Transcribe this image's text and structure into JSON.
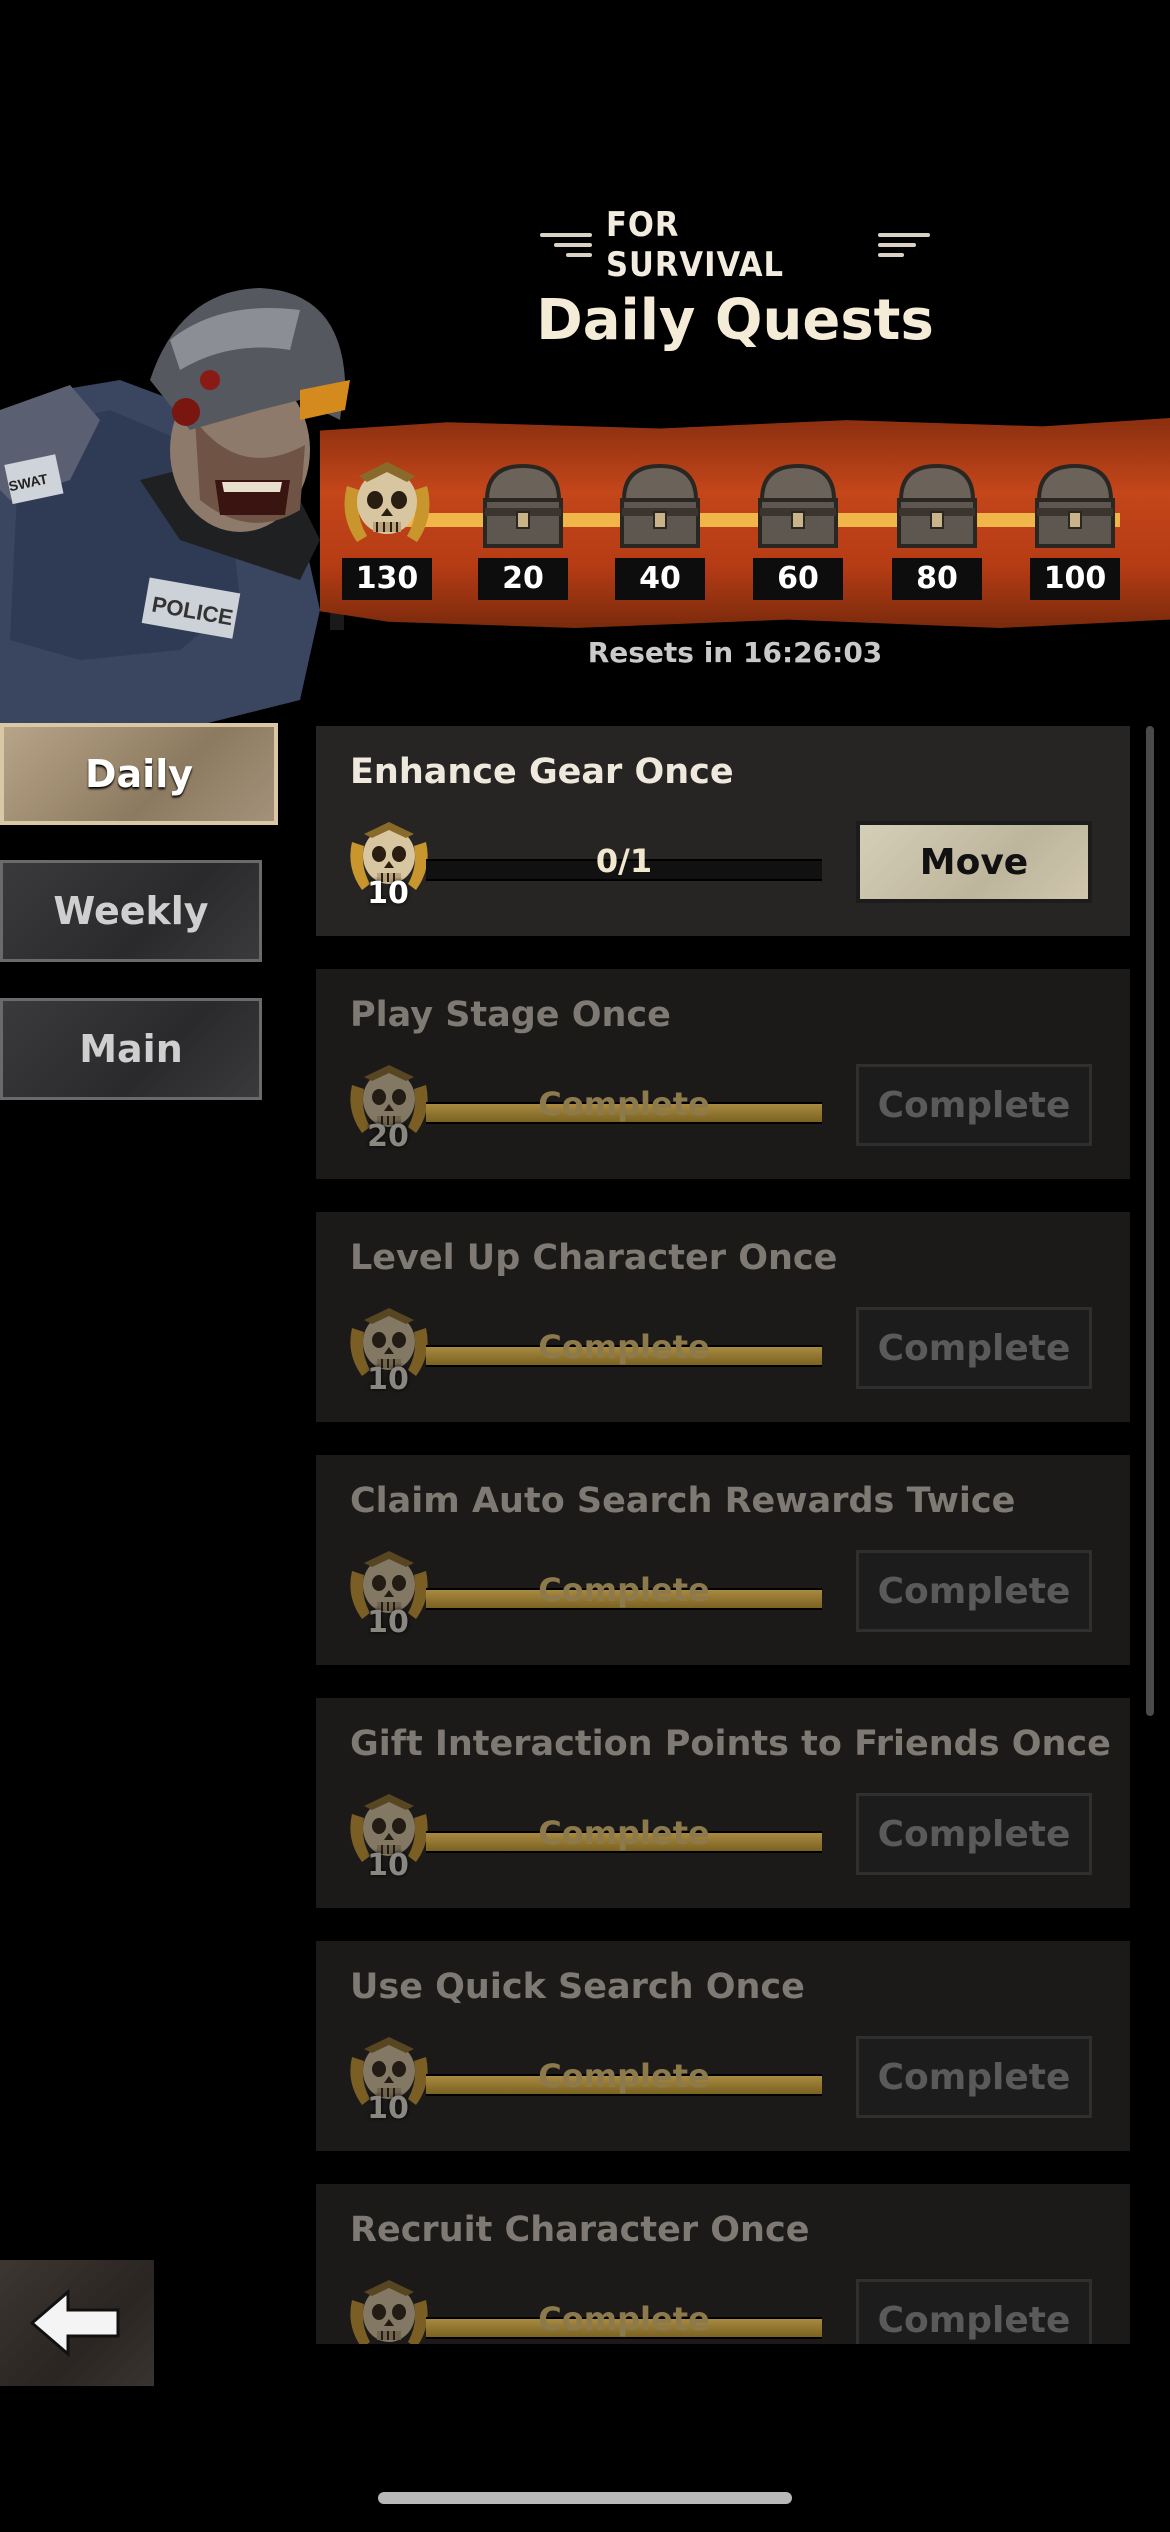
{
  "header": {
    "subtitle": "FOR SURVIVAL",
    "title": "Daily Quests"
  },
  "reward_track": {
    "milestones": [
      {
        "value": "130",
        "icon": "skull-emblem-icon"
      },
      {
        "value": "20",
        "icon": "chest-icon"
      },
      {
        "value": "40",
        "icon": "chest-icon"
      },
      {
        "value": "60",
        "icon": "chest-icon"
      },
      {
        "value": "80",
        "icon": "chest-icon"
      },
      {
        "value": "100",
        "icon": "chest-icon"
      }
    ],
    "resets_text": "Resets in 16:26:03"
  },
  "tabs": [
    {
      "label": "Daily",
      "selected": true
    },
    {
      "label": "Weekly",
      "selected": false
    },
    {
      "label": "Main",
      "selected": false
    }
  ],
  "quests": [
    {
      "title": "Enhance Gear Once",
      "reward": "10",
      "progress_text": "0/1",
      "progress": 0,
      "action": "Move",
      "done": false
    },
    {
      "title": "Play Stage Once",
      "reward": "20",
      "progress_text": "Complete",
      "progress": 1,
      "action": "Complete",
      "done": true
    },
    {
      "title": "Level Up Character Once",
      "reward": "10",
      "progress_text": "Complete",
      "progress": 1,
      "action": "Complete",
      "done": true
    },
    {
      "title": "Claim Auto Search Rewards Twice",
      "reward": "10",
      "progress_text": "Complete",
      "progress": 1,
      "action": "Complete",
      "done": true
    },
    {
      "title": "Gift Interaction Points to Friends Once",
      "reward": "10",
      "progress_text": "Complete",
      "progress": 1,
      "action": "Complete",
      "done": true
    },
    {
      "title": "Use Quick Search Once",
      "reward": "10",
      "progress_text": "Complete",
      "progress": 1,
      "action": "Complete",
      "done": true
    },
    {
      "title": "Recruit Character Once",
      "reward": "",
      "progress_text": "Complete",
      "progress": 1,
      "action": "Complete",
      "done": true
    }
  ],
  "colors": {
    "banner": "#c4461a",
    "track": "#f0b64a",
    "progress_fill": "#a88a42"
  }
}
